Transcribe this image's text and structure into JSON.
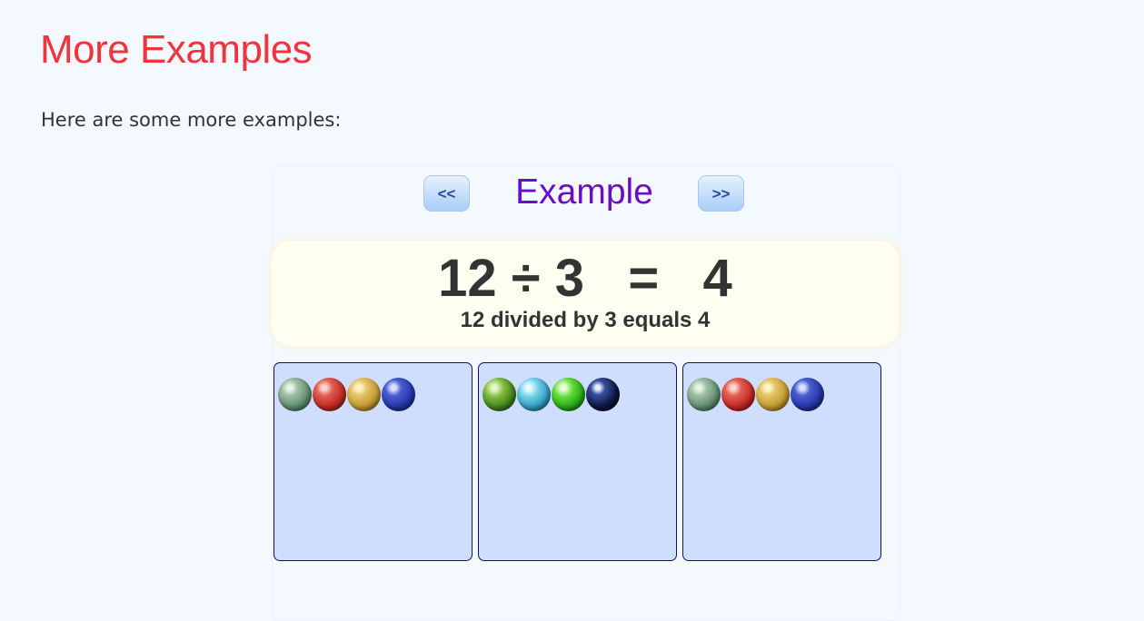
{
  "heading": "More Examples",
  "intro": "Here are some more examples:",
  "example": {
    "title": "Example",
    "prev_label": "<<",
    "next_label": ">>",
    "equation": "12 ÷ 3   =   4",
    "equation_words": "12 divided by 3 equals 4",
    "groups": [
      {
        "marbles": [
          "green-speckled-marble",
          "red-speckled-marble",
          "gold-speckled-marble",
          "blue-marble"
        ]
      },
      {
        "marbles": [
          "green-swirl-marble",
          "teal-swirl-marble",
          "green-marble",
          "dark-blue-marble"
        ]
      },
      {
        "marbles": [
          "green-speckled-marble",
          "red-speckled-marble",
          "gold-speckled-marble",
          "blue-marble"
        ]
      }
    ]
  },
  "colors": {
    "heading": "#f0343c",
    "example_title": "#6a0dc6",
    "group_fill": "#cfdefc",
    "group_border": "#101070",
    "equation_bg": "#fffff1"
  }
}
